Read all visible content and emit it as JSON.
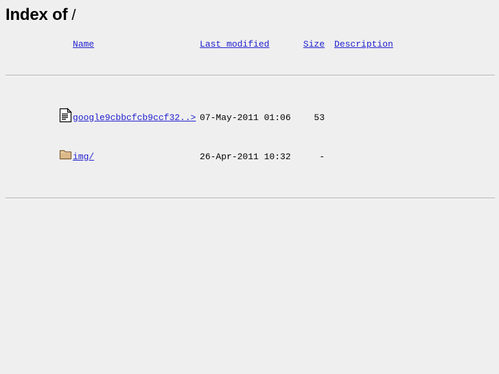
{
  "document": {
    "title": "Index of /",
    "heading_prefix": "Index of",
    "directory_path": "/"
  },
  "colors": {
    "background": "#efefef",
    "link": "#2020d0",
    "text": "#000000",
    "rule": "#b0b0b0",
    "folder_fill": "#dbb98a",
    "folder_outline": "#7a5a2e",
    "document_fill": "#ffffff",
    "document_outline": "#000000"
  },
  "table": {
    "columns": [
      {
        "key": "icon",
        "label": "",
        "sortable": false
      },
      {
        "key": "name",
        "label": "Name",
        "sortable": true
      },
      {
        "key": "date",
        "label": "Last modified",
        "sortable": true
      },
      {
        "key": "size",
        "label": "Size",
        "sortable": true
      },
      {
        "key": "description",
        "label": "Description",
        "sortable": true
      }
    ],
    "rows": [
      {
        "icon": "text-file-icon",
        "icon_alt": "[TXT]",
        "name": "google9cbbcfcb9ccf32..>",
        "date": "07-May-2011 01:06",
        "size": "53",
        "description": ""
      },
      {
        "icon": "folder-icon",
        "icon_alt": "[DIR]",
        "name": "img/",
        "date": "26-Apr-2011 10:32",
        "size": "-",
        "description": ""
      }
    ]
  }
}
